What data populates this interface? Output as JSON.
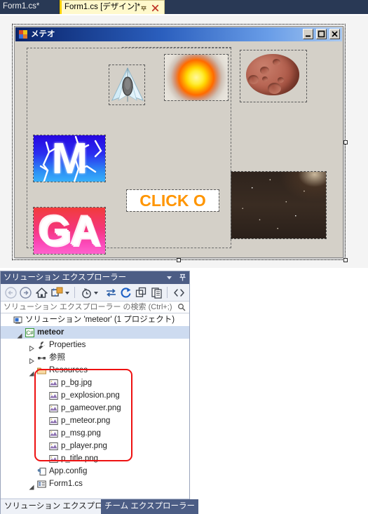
{
  "tabs": {
    "inactive_label": "Form1.cs*",
    "active_label": "Form1.cs [デザイン]*",
    "pin_icon": "pin-icon",
    "close_icon": "close-icon"
  },
  "designer": {
    "form_title": "メテオ",
    "form_icon": "form-app-icon",
    "window_buttons": {
      "minimize": "minimize-icon",
      "maximize": "maximize-icon",
      "close": "close-icon"
    },
    "controls": [
      {
        "name": "player-picturebox",
        "sprite": "p_player.png"
      },
      {
        "name": "explosion-picturebox",
        "sprite": "p_explosion.png"
      },
      {
        "name": "meteor-picturebox",
        "sprite": "p_meteor.png"
      },
      {
        "name": "title-picturebox",
        "sprite": "p_title.png",
        "text": "M"
      },
      {
        "name": "gameover-picturebox",
        "sprite": "p_gameover.png",
        "text": "GA"
      },
      {
        "name": "msg-picturebox",
        "sprite": "p_msg.png",
        "text": "CLICK O"
      },
      {
        "name": "background-picturebox",
        "sprite": "p_bg.jpg"
      }
    ]
  },
  "solution_explorer": {
    "title": "ソリューション エクスプローラー",
    "header_icons": {
      "dropdown": "chevron-down-icon",
      "pin": "pin-icon"
    },
    "toolbar": [
      {
        "name": "back-button",
        "icon": "arrow-left-icon"
      },
      {
        "name": "forward-button",
        "icon": "arrow-right-icon"
      },
      {
        "name": "home-button",
        "icon": "home-icon"
      },
      {
        "name": "solution-views-button",
        "icon": "solution-views-icon"
      },
      {
        "name": "solution-views-dropdown",
        "icon": "chevron-down-icon"
      },
      {
        "name": "pending-changes-button",
        "icon": "clock-icon"
      },
      {
        "name": "pending-changes-dropdown",
        "icon": "chevron-down-icon"
      },
      {
        "name": "sync-button",
        "icon": "sync-arrows-icon"
      },
      {
        "name": "refresh-button",
        "icon": "refresh-icon"
      },
      {
        "name": "collapse-all-button",
        "icon": "collapse-all-icon"
      },
      {
        "name": "show-all-files-button",
        "icon": "show-all-files-icon"
      },
      {
        "name": "view-code-button",
        "icon": "angle-brackets-icon"
      }
    ],
    "search_placeholder": "ソリューション エクスプローラー の検索 (Ctrl+;)",
    "search_icon": "magnifier-icon",
    "tree": [
      {
        "label": "ソリューション 'meteor' (1 プロジェクト)",
        "icon": "solution-icon",
        "depth": 0,
        "expander": "none",
        "bold": false,
        "selected": false
      },
      {
        "label": "meteor",
        "icon": "csharp-project-icon",
        "depth": 1,
        "expander": "expanded",
        "bold": true,
        "selected": true
      },
      {
        "label": "Properties",
        "icon": "wrench-icon",
        "depth": 2,
        "expander": "collapsed",
        "bold": false,
        "selected": false
      },
      {
        "label": "参照",
        "icon": "references-icon",
        "depth": 2,
        "expander": "collapsed",
        "bold": false,
        "selected": false
      },
      {
        "label": "Resources",
        "icon": "folder-icon",
        "depth": 2,
        "expander": "expanded",
        "bold": false,
        "selected": false
      },
      {
        "label": "p_bg.jpg",
        "icon": "image-file-icon",
        "depth": 3,
        "expander": "none",
        "bold": false,
        "selected": false
      },
      {
        "label": "p_explosion.png",
        "icon": "image-file-icon",
        "depth": 3,
        "expander": "none",
        "bold": false,
        "selected": false
      },
      {
        "label": "p_gameover.png",
        "icon": "image-file-icon",
        "depth": 3,
        "expander": "none",
        "bold": false,
        "selected": false
      },
      {
        "label": "p_meteor.png",
        "icon": "image-file-icon",
        "depth": 3,
        "expander": "none",
        "bold": false,
        "selected": false
      },
      {
        "label": "p_msg.png",
        "icon": "image-file-icon",
        "depth": 3,
        "expander": "none",
        "bold": false,
        "selected": false
      },
      {
        "label": "p_player.png",
        "icon": "image-file-icon",
        "depth": 3,
        "expander": "none",
        "bold": false,
        "selected": false
      },
      {
        "label": "p_title.png",
        "icon": "image-file-icon",
        "depth": 3,
        "expander": "none",
        "bold": false,
        "selected": false
      },
      {
        "label": "App.config",
        "icon": "config-file-icon",
        "depth": 2,
        "expander": "none",
        "bold": false,
        "selected": false
      },
      {
        "label": "Form1.cs",
        "icon": "form-file-icon",
        "depth": 2,
        "expander": "expanded",
        "bold": false,
        "selected": false
      }
    ],
    "annotation": {
      "name": "red-highlight-box",
      "color": "#ee1111"
    },
    "bottom_tabs": [
      {
        "label": "ソリューション エクスプローラー",
        "active": true
      },
      {
        "label": "チーム エクスプローラー",
        "active": false
      }
    ]
  }
}
